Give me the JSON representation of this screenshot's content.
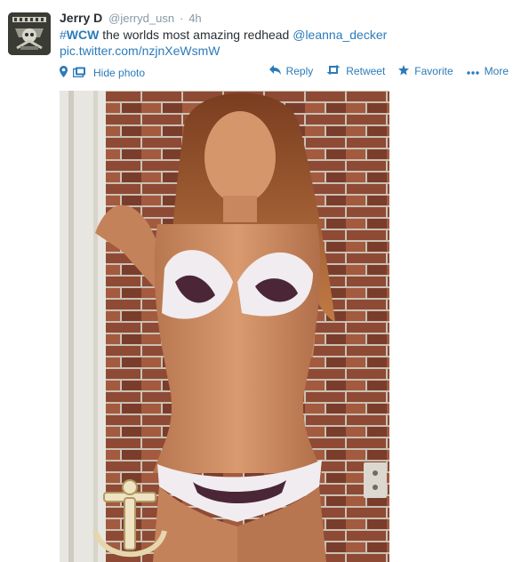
{
  "tweet": {
    "fullname": "Jerry D",
    "username": "@jerryd_usn",
    "dot": "·",
    "timestamp": "4h",
    "hashtag_symbol": "#",
    "hashtag": "WCW",
    "text_middle": " the worlds most amazing redhead ",
    "mention": "@leanna_decker",
    "pic_link": "pic.twitter.com/nzjnXeWsmW",
    "hide_photo_label": "Hide photo"
  },
  "actions": [
    {
      "label": "Reply",
      "icon": "reply-icon"
    },
    {
      "label": "Retweet",
      "icon": "retweet-icon"
    },
    {
      "label": "Favorite",
      "icon": "star-icon"
    },
    {
      "label": "More",
      "icon": "more-icon"
    }
  ],
  "colors": {
    "link": "#2b7bb9",
    "muted": "#8899a6",
    "text": "#292f33",
    "brick": "#8a4a33"
  }
}
